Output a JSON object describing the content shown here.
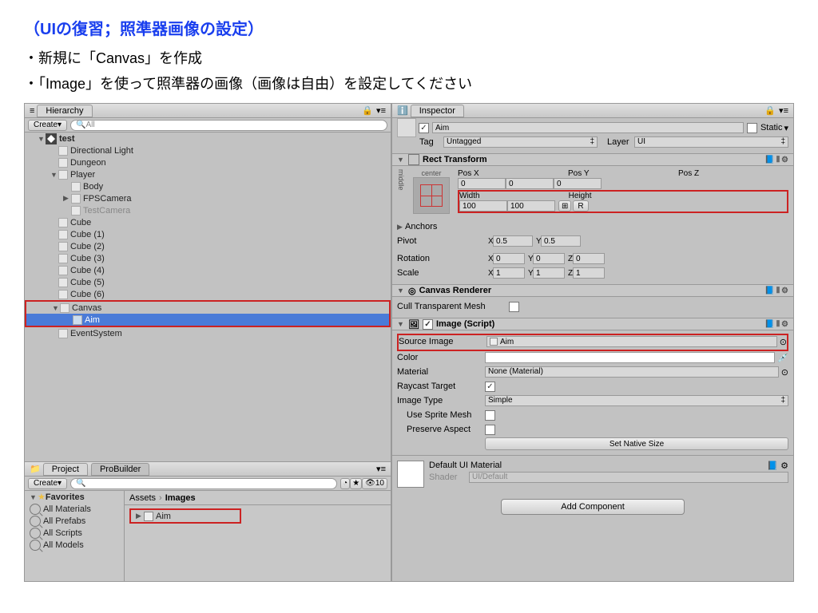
{
  "title": "（UIの復習；照準器画像の設定）",
  "bullets": [
    "・新規に「Canvas」を作成",
    "・「Image」を使って照準器の画像（画像は自由）を設定してください"
  ],
  "hierarchy": {
    "tab": "Hierarchy",
    "create": "Create",
    "searchPlaceholder": "All",
    "root": "test",
    "items": [
      "Directional Light",
      "Dungeon",
      "Player",
      "Body",
      "FPSCamera",
      "TestCamera",
      "Cube",
      "Cube (1)",
      "Cube (2)",
      "Cube (3)",
      "Cube (4)",
      "Cube (5)",
      "Cube (6)",
      "Canvas",
      "Aim",
      "EventSystem"
    ]
  },
  "project": {
    "tab1": "Project",
    "tab2": "ProBuilder",
    "create": "Create",
    "favorites": "Favorites",
    "favs": [
      "All Materials",
      "All Prefabs",
      "All Scripts",
      "All Models"
    ],
    "breadcrumb": [
      "Assets",
      "Images"
    ],
    "item": "Aim",
    "count": "10"
  },
  "inspector": {
    "tab": "Inspector",
    "name": "Aim",
    "static": "Static",
    "tag": "Tag",
    "tagValue": "Untagged",
    "layer": "Layer",
    "layerValue": "UI",
    "rect": {
      "title": "Rect Transform",
      "center": "center",
      "middle": "middle",
      "posX": "Pos X",
      "posY": "Pos Y",
      "posZ": "Pos Z",
      "posXv": "0",
      "posYv": "0",
      "posZv": "0",
      "width": "Width",
      "height": "Height",
      "widthv": "100",
      "heightv": "100",
      "r": "R",
      "anchors": "Anchors",
      "pivot": "Pivot",
      "pivotX": "0.5",
      "pivotY": "0.5",
      "rotation": "Rotation",
      "rX": "0",
      "rY": "0",
      "rZ": "0",
      "scale": "Scale",
      "sX": "1",
      "sY": "1",
      "sZ": "1"
    },
    "canvasRenderer": {
      "title": "Canvas Renderer",
      "cull": "Cull Transparent Mesh"
    },
    "image": {
      "title": "Image (Script)",
      "sourceImage": "Source Image",
      "sourceImageValue": "Aim",
      "color": "Color",
      "material": "Material",
      "materialValue": "None (Material)",
      "raycast": "Raycast Target",
      "imageType": "Image Type",
      "imageTypeValue": "Simple",
      "useSprite": "Use Sprite Mesh",
      "preserve": "Preserve Aspect",
      "setNative": "Set Native Size"
    },
    "mat": {
      "title": "Default UI Material",
      "shader": "Shader",
      "shaderValue": "UI/Default"
    },
    "addComponent": "Add Component"
  }
}
